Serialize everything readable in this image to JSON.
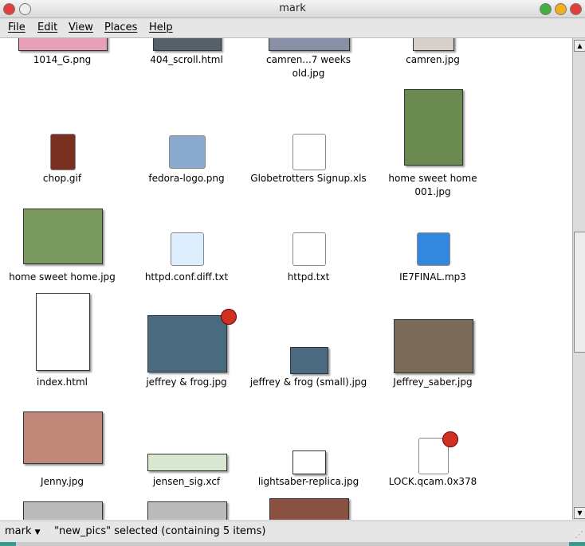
{
  "window": {
    "title": "mark"
  },
  "menu": [
    {
      "label": "File"
    },
    {
      "label": "Edit"
    },
    {
      "label": "View"
    },
    {
      "label": "Places"
    },
    {
      "label": "Help"
    }
  ],
  "files": [
    {
      "name": "1014_G.png",
      "icon": "image-thumbnail",
      "color": "#e8a0b8"
    },
    {
      "name": "404_scroll.html",
      "icon": "html-thumbnail",
      "color": "#556068"
    },
    {
      "name": "camren...7 weeks old.jpg",
      "icon": "image-thumbnail",
      "color": "#8890a8"
    },
    {
      "name": "camren.jpg",
      "icon": "image-thumbnail",
      "color": "#d8d0c8"
    },
    {
      "name": "chop.gif",
      "icon": "guillotine-icon",
      "color": "#7a3020"
    },
    {
      "name": "fedora-logo.png",
      "icon": "computer-icon",
      "color": "#88aacc"
    },
    {
      "name": "Globetrotters Signup.xls",
      "icon": "spreadsheet-icon",
      "color": "#ffffff"
    },
    {
      "name": "home sweet home 001.jpg",
      "icon": "image-thumbnail",
      "color": "#6a8a50"
    },
    {
      "name": "home sweet home.jpg",
      "icon": "image-thumbnail",
      "color": "#7a9a60"
    },
    {
      "name": "httpd.conf.diff.txt",
      "icon": "text-file-icon",
      "color": "#ddeeff"
    },
    {
      "name": "httpd.txt",
      "icon": "text-file-icon",
      "color": "#ffffff"
    },
    {
      "name": "IE7FINAL.mp3",
      "icon": "audio-file-icon",
      "color": "#3388dd"
    },
    {
      "name": "index.html",
      "icon": "html-thumbnail",
      "color": "#ffffff"
    },
    {
      "name": "jeffrey & frog.jpg",
      "icon": "image-thumbnail",
      "color": "#4a6a80",
      "emblem": "no-read-emblem"
    },
    {
      "name": "jeffrey & frog (small).jpg",
      "icon": "image-thumbnail",
      "color": "#4a6a80"
    },
    {
      "name": "Jeffrey_saber.jpg",
      "icon": "image-thumbnail",
      "color": "#7a6a58"
    },
    {
      "name": "Jenny.jpg",
      "icon": "image-thumbnail",
      "color": "#c08878"
    },
    {
      "name": "jensen_sig.xcf",
      "icon": "image-thumbnail",
      "color": "#d8e8d0"
    },
    {
      "name": "lightsaber-replica.jpg",
      "icon": "image-thumbnail",
      "color": "#ffffff"
    },
    {
      "name": "LOCK.qcam.0x378",
      "icon": "blank-file-icon",
      "color": "#ffffff",
      "emblem": "no-read-emblem"
    },
    {
      "name": "",
      "icon": "image-thumbnail",
      "color": "#bbbbbb"
    },
    {
      "name": "",
      "icon": "image-thumbnail",
      "color": "#bbbbbb"
    },
    {
      "name": "",
      "icon": "image-thumbnail",
      "color": "#8a5040"
    }
  ],
  "status": {
    "location": "mark",
    "message": "\"new_pics\" selected (containing 5 items)"
  }
}
